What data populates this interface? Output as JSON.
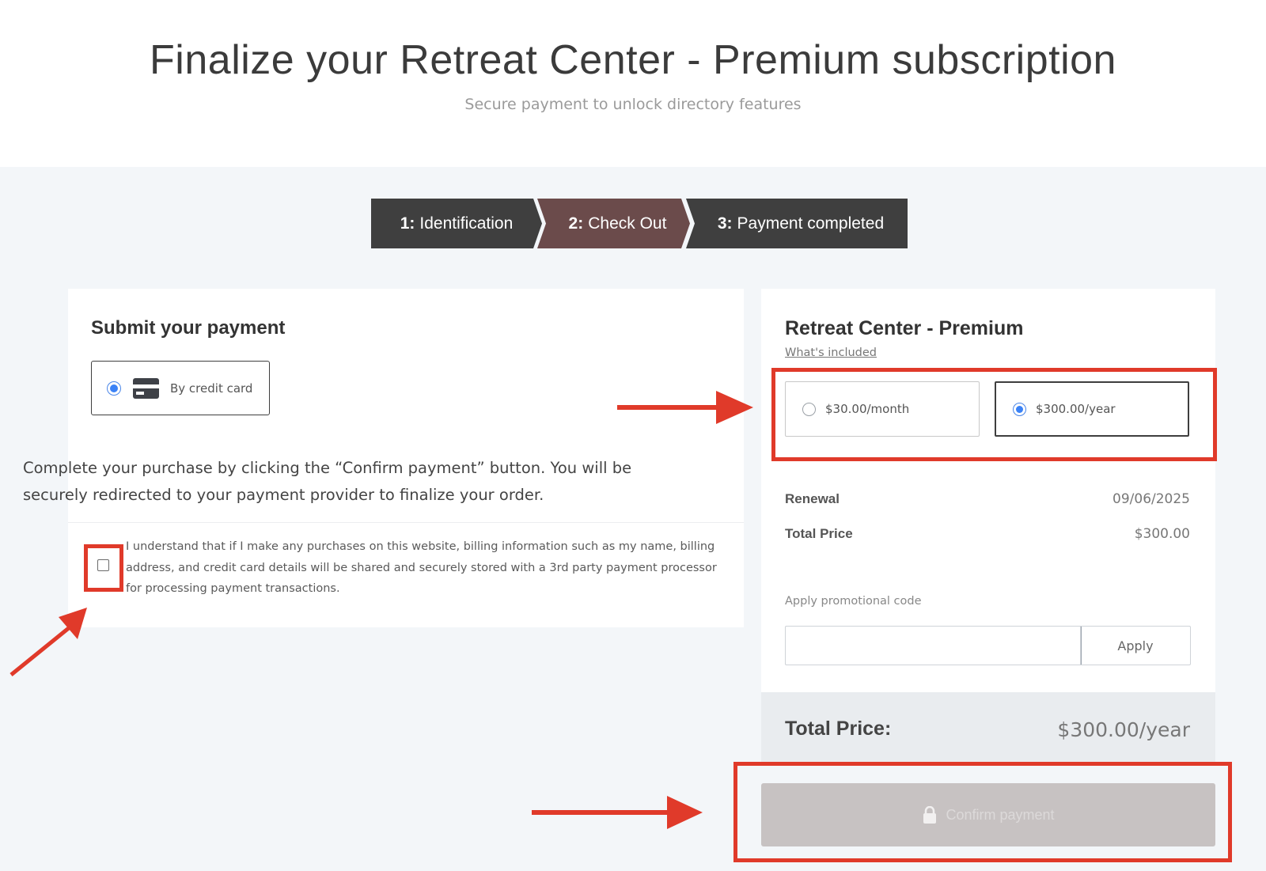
{
  "header": {
    "title": "Finalize your Retreat Center - Premium subscription",
    "subtitle": "Secure payment to unlock directory features"
  },
  "stepper": {
    "steps": [
      {
        "number": "1:",
        "label": "Identification"
      },
      {
        "number": "2:",
        "label": "Check Out"
      },
      {
        "number": "3:",
        "label": "Payment completed"
      }
    ]
  },
  "payment": {
    "title": "Submit your payment",
    "method_label": "By credit card",
    "description": "Complete your purchase by clicking the “Confirm payment” button. You will be securely redirected to your payment provider to finalize your order.",
    "consent_text": "I understand that if I make any purchases on this website, billing information such as my name, billing address, and credit card details will be shared and securely stored with a 3rd party payment processor for processing payment transactions."
  },
  "plan": {
    "title": "Retreat Center - Premium",
    "whats_included": "What's included",
    "options": [
      {
        "label": "$30.00/month",
        "selected": false
      },
      {
        "label": "$300.00/year",
        "selected": true
      }
    ],
    "renewal_label": "Renewal",
    "renewal_value": "09/06/2025",
    "total_price_label": "Total Price",
    "total_price_value": "$300.00",
    "promo_label": "Apply promotional code",
    "promo_value": "",
    "apply_label": "Apply"
  },
  "summary": {
    "total_label": "Total Price:",
    "total_value": "$300.00/year",
    "confirm_label": "Confirm payment"
  },
  "colors": {
    "stepper_dark": "#3f3f3f",
    "stepper_active": "#6b4b4b",
    "radio_accent": "#3b82f6",
    "annotation_red": "#e03a2a",
    "confirm_disabled": "#c7c2c2"
  }
}
